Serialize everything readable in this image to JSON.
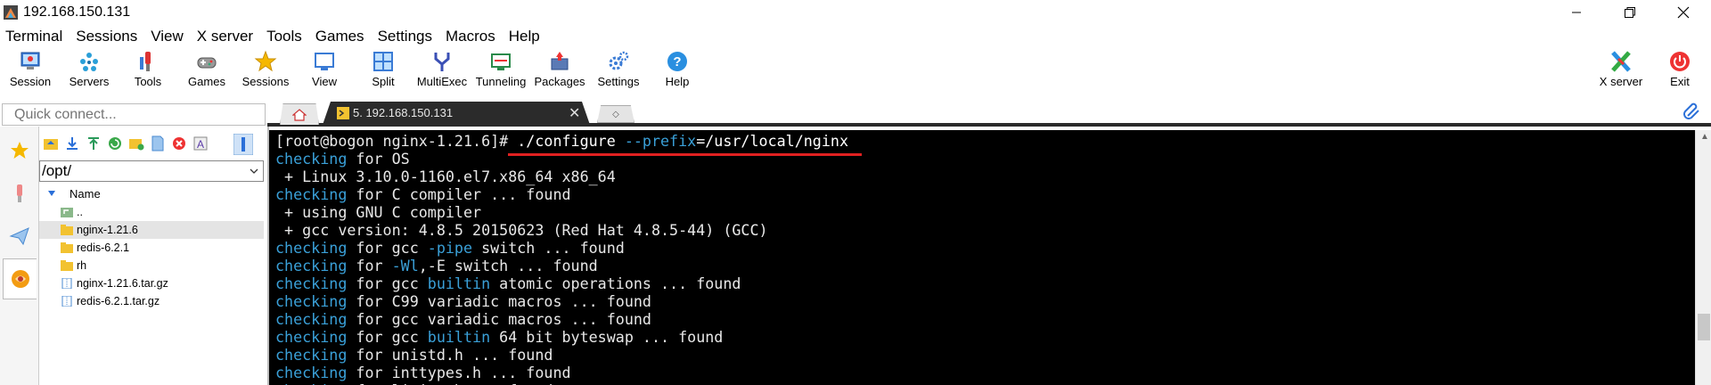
{
  "window": {
    "title": "192.168.150.131"
  },
  "menu": [
    "Terminal",
    "Sessions",
    "View",
    "X server",
    "Tools",
    "Games",
    "Settings",
    "Macros",
    "Help"
  ],
  "toolbar": {
    "left": [
      {
        "label": "Session",
        "icon": "session-icon"
      },
      {
        "label": "Servers",
        "icon": "servers-icon"
      },
      {
        "label": "Tools",
        "icon": "tools-icon"
      },
      {
        "label": "Games",
        "icon": "games-icon"
      },
      {
        "label": "Sessions",
        "icon": "star-icon"
      },
      {
        "label": "View",
        "icon": "view-icon"
      },
      {
        "label": "Split",
        "icon": "split-icon"
      },
      {
        "label": "MultiExec",
        "icon": "multiexec-icon"
      },
      {
        "label": "Tunneling",
        "icon": "tunneling-icon"
      },
      {
        "label": "Packages",
        "icon": "packages-icon"
      },
      {
        "label": "Settings",
        "icon": "gear-icon"
      },
      {
        "label": "Help",
        "icon": "help-icon"
      }
    ],
    "right": [
      {
        "label": "X server",
        "icon": "xserver-icon"
      },
      {
        "label": "Exit",
        "icon": "power-icon"
      }
    ]
  },
  "quick_connect": {
    "placeholder": "Quick connect..."
  },
  "tabs": {
    "session_tab": "5. 192.168.150.131"
  },
  "file_panel": {
    "path": "/opt/",
    "column_header": "Name",
    "items": [
      {
        "name": "..",
        "type": "parent",
        "selected": false
      },
      {
        "name": "nginx-1.21.6",
        "type": "folder",
        "selected": true
      },
      {
        "name": "redis-6.2.1",
        "type": "folder",
        "selected": false
      },
      {
        "name": "rh",
        "type": "folder",
        "selected": false
      },
      {
        "name": "nginx-1.21.6.tar.gz",
        "type": "file",
        "selected": false
      },
      {
        "name": "redis-6.2.1.tar.gz",
        "type": "file",
        "selected": false
      }
    ]
  },
  "terminal": {
    "lines": [
      [
        {
          "t": "[root@bogon nginx-1.21.6]# ",
          "c": ""
        },
        {
          "t": "./configure ",
          "c": "cmd"
        },
        {
          "t": "--prefix",
          "c": "kw"
        },
        {
          "t": "=/usr/local/nginx",
          "c": "cmd"
        }
      ],
      [
        {
          "t": "checking",
          "c": "kw"
        },
        {
          "t": " for OS",
          "c": ""
        }
      ],
      [
        {
          "t": " + Linux 3.10.0-1160.el7.x86_64 x86_64",
          "c": ""
        }
      ],
      [
        {
          "t": "checking",
          "c": "kw"
        },
        {
          "t": " for C compiler ... found",
          "c": ""
        }
      ],
      [
        {
          "t": " + using GNU C compiler",
          "c": ""
        }
      ],
      [
        {
          "t": " + gcc version: 4.8.5 20150623 (Red Hat 4.8.5-44) (GCC)",
          "c": ""
        }
      ],
      [
        {
          "t": "checking",
          "c": "kw"
        },
        {
          "t": " for gcc ",
          "c": ""
        },
        {
          "t": "-pipe",
          "c": "kw"
        },
        {
          "t": " switch ... found",
          "c": ""
        }
      ],
      [
        {
          "t": "checking",
          "c": "kw"
        },
        {
          "t": " for ",
          "c": ""
        },
        {
          "t": "-Wl",
          "c": "kw"
        },
        {
          "t": ",-E switch ... found",
          "c": ""
        }
      ],
      [
        {
          "t": "checking",
          "c": "kw"
        },
        {
          "t": " for gcc ",
          "c": ""
        },
        {
          "t": "builtin",
          "c": "kw"
        },
        {
          "t": " atomic operations ... found",
          "c": ""
        }
      ],
      [
        {
          "t": "checking",
          "c": "kw"
        },
        {
          "t": " for C99 variadic macros ... found",
          "c": ""
        }
      ],
      [
        {
          "t": "checking",
          "c": "kw"
        },
        {
          "t": " for gcc variadic macros ... found",
          "c": ""
        }
      ],
      [
        {
          "t": "checking",
          "c": "kw"
        },
        {
          "t": " for gcc ",
          "c": ""
        },
        {
          "t": "builtin",
          "c": "kw"
        },
        {
          "t": " 64 bit byteswap ... found",
          "c": ""
        }
      ],
      [
        {
          "t": "checking",
          "c": "kw"
        },
        {
          "t": " for unistd.h ... found",
          "c": ""
        }
      ],
      [
        {
          "t": "checking",
          "c": "kw"
        },
        {
          "t": " for inttypes.h ... found",
          "c": ""
        }
      ],
      [
        {
          "t": "checking",
          "c": "kw"
        },
        {
          "t": " for limits.h ... found",
          "c": ""
        }
      ]
    ]
  },
  "colors": {
    "terminal_bg": "#000000",
    "keyword": "#3aa0d8",
    "annotation_underline": "#e02020",
    "folder": "#f2c230"
  }
}
